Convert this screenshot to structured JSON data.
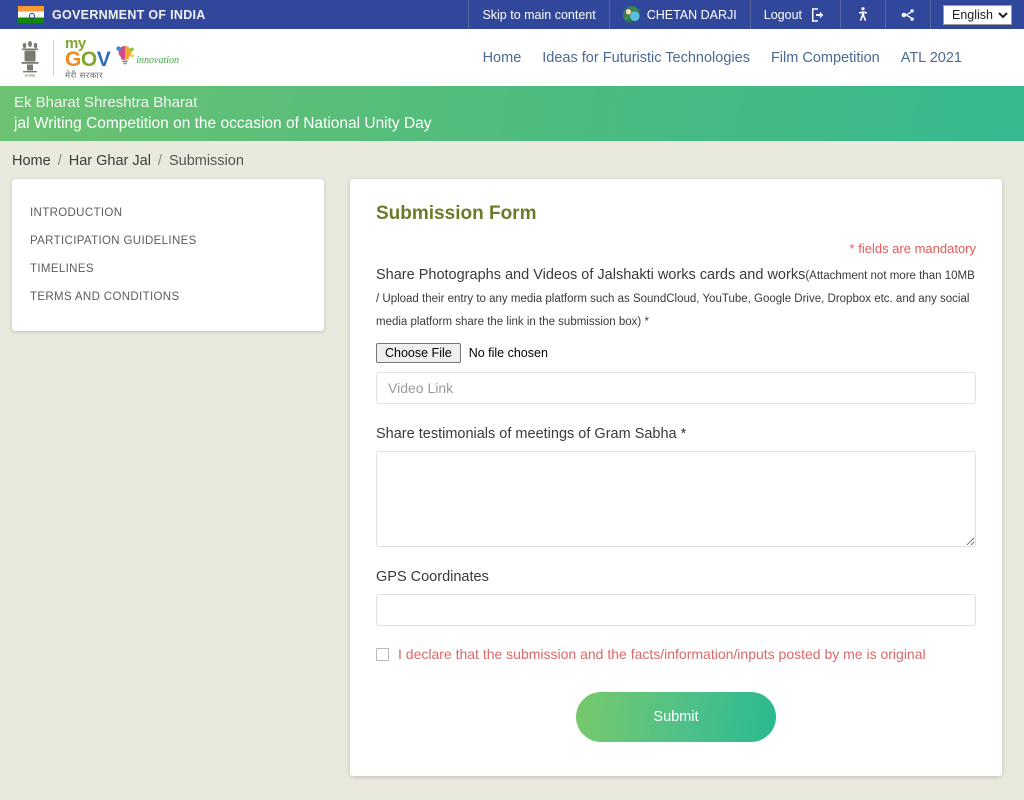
{
  "gov_bar": {
    "flag_icon": "india-flag-icon",
    "government_label": "GOVERNMENT OF INDIA",
    "skip_link": "Skip to main content",
    "user_name": "CHETAN DARJI",
    "logout_label": "Logout",
    "logout_icon": "logout-icon",
    "accessibility_icon": "accessibility-icon",
    "sitemap_icon": "sitemap-icon",
    "language": "English",
    "language_options": [
      "English"
    ],
    "bar_color": "#31479b"
  },
  "header": {
    "emblem_icon": "india-emblem-icon",
    "logo_my": "my",
    "logo_gov": "GOV",
    "logo_hindi": "मेरी सरकार",
    "logo_innovation": "innovation",
    "innovation_icon": "lightbulb-icon",
    "nav": [
      {
        "label": "Home"
      },
      {
        "label": "Ideas for Futuristic Technologies"
      },
      {
        "label": "Film Competition"
      },
      {
        "label": "ATL 2021"
      }
    ],
    "nav_color": "#4a6a93"
  },
  "banner": {
    "line1": "Ek Bharat Shreshtra Bharat",
    "line2": "jal Writing Competition on the occasion of National Unity Day",
    "gradient_from": "#6cc271",
    "gradient_to": "#35b98f"
  },
  "breadcrumb": {
    "items": [
      {
        "label": "Home"
      },
      {
        "label": "Har Ghar Jal"
      },
      {
        "label": "Submission"
      }
    ],
    "separator": "/"
  },
  "sidebar": {
    "items": [
      {
        "label": "INTRODUCTION"
      },
      {
        "label": "PARTICIPATION GUIDELINES"
      },
      {
        "label": "TIMELINES"
      },
      {
        "label": "TERMS AND CONDITIONS"
      }
    ]
  },
  "form": {
    "title": "Submission Form",
    "mandatory_note": "* fields are mandatory",
    "mandatory_color": "#e05a5a",
    "title_color": "#6e7a29",
    "photo_field": {
      "label_main": "Share Photographs and Videos of Jalshakti works cards and works",
      "label_small": "(Attachment not more than 10MB / Upload their entry to any media platform such as SoundCloud, YouTube, Google Drive, Dropbox etc. and any social media platform share the link in the submission box) *",
      "choose_file_label": "Choose File",
      "file_status": "No file chosen",
      "video_link_placeholder": "Video Link",
      "video_link_value": ""
    },
    "testimonials_field": {
      "label": "Share testimonials of meetings of Gram Sabha *",
      "value": "",
      "placeholder": ""
    },
    "gps_field": {
      "label": "GPS Coordinates",
      "value": "",
      "placeholder": ""
    },
    "declaration": {
      "text": "I declare that the submission and the facts/information/inputs posted by me is original",
      "checked": false,
      "color": "#d86a6a"
    },
    "submit_label": "Submit",
    "submit_gradient_from": "#78c96b",
    "submit_gradient_to": "#2ab98f"
  },
  "page": {
    "background": "#eae9dd"
  }
}
